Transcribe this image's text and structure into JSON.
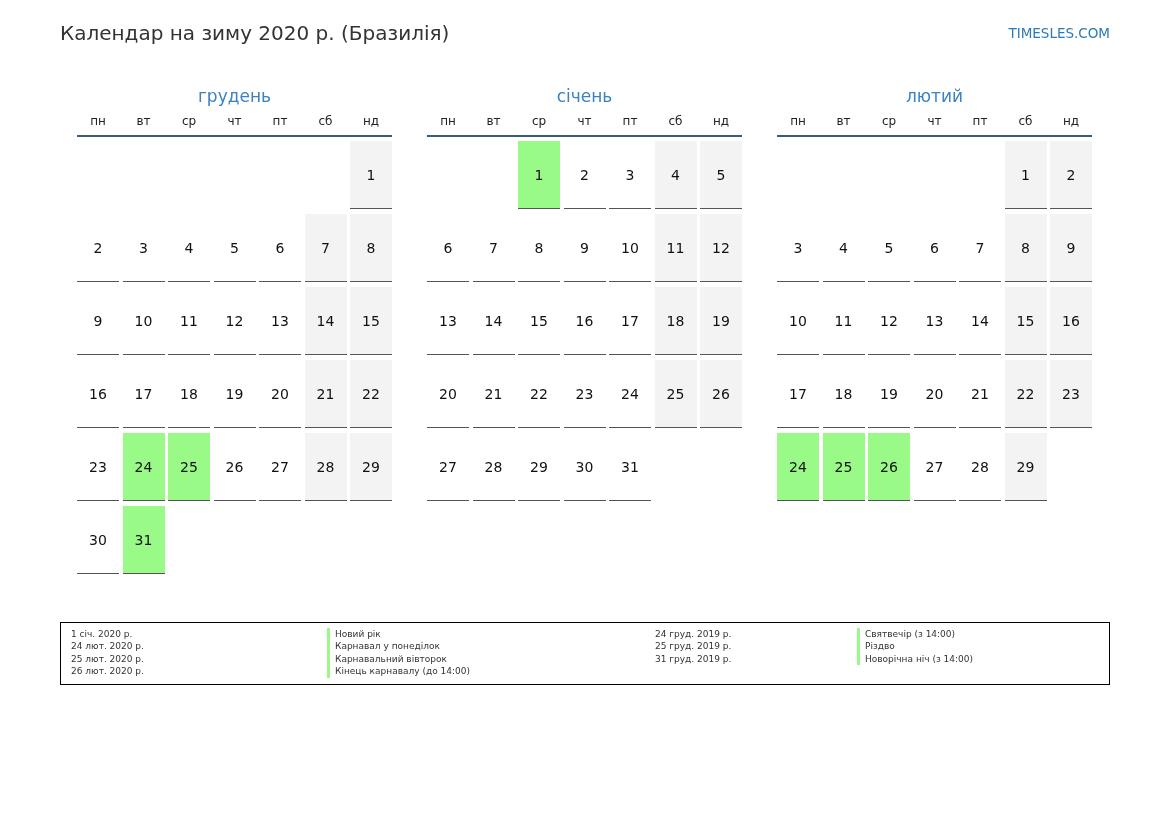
{
  "title": "Календар на зиму 2020 р. (Бразилія)",
  "site_link": "TIMESLES.COM",
  "months": [
    {
      "name": "грудень",
      "weekdays": [
        "пн",
        "вт",
        "ср",
        "чт",
        "пт",
        "сб",
        "нд"
      ],
      "weeks": [
        [
          {
            "day": "1",
            "kind": "weekend"
          }
        ],
        [
          {
            "day": "2",
            "kind": "workday"
          },
          {
            "day": "3",
            "kind": "workday"
          },
          {
            "day": "4",
            "kind": "workday"
          },
          {
            "day": "5",
            "kind": "workday"
          },
          {
            "day": "6",
            "kind": "workday"
          },
          {
            "day": "7",
            "kind": "weekend"
          },
          {
            "day": "8",
            "kind": "weekend"
          }
        ],
        [
          {
            "day": "9",
            "kind": "workday"
          },
          {
            "day": "10",
            "kind": "workday"
          },
          {
            "day": "11",
            "kind": "workday"
          },
          {
            "day": "12",
            "kind": "workday"
          },
          {
            "day": "13",
            "kind": "workday"
          },
          {
            "day": "14",
            "kind": "weekend"
          },
          {
            "day": "15",
            "kind": "weekend"
          }
        ],
        [
          {
            "day": "16",
            "kind": "workday"
          },
          {
            "day": "17",
            "kind": "workday"
          },
          {
            "day": "18",
            "kind": "workday"
          },
          {
            "day": "19",
            "kind": "workday"
          },
          {
            "day": "20",
            "kind": "workday"
          },
          {
            "day": "21",
            "kind": "weekend"
          },
          {
            "day": "22",
            "kind": "weekend"
          }
        ],
        [
          {
            "day": "23",
            "kind": "workday"
          },
          {
            "day": "24",
            "kind": "holiday"
          },
          {
            "day": "25",
            "kind": "holiday"
          },
          {
            "day": "26",
            "kind": "workday"
          },
          {
            "day": "27",
            "kind": "workday"
          },
          {
            "day": "28",
            "kind": "weekend"
          },
          {
            "day": "29",
            "kind": "weekend"
          }
        ],
        [
          {
            "day": "30",
            "kind": "workday"
          },
          {
            "day": "31",
            "kind": "holiday"
          }
        ]
      ]
    },
    {
      "name": "січень",
      "weekdays": [
        "пн",
        "вт",
        "ср",
        "чт",
        "пт",
        "сб",
        "нд"
      ],
      "weeks": [
        [
          {
            "day": "1",
            "kind": "holiday"
          },
          {
            "day": "2",
            "kind": "workday"
          },
          {
            "day": "3",
            "kind": "workday"
          },
          {
            "day": "4",
            "kind": "weekend"
          },
          {
            "day": "5",
            "kind": "weekend"
          }
        ],
        [
          {
            "day": "6",
            "kind": "workday"
          },
          {
            "day": "7",
            "kind": "workday"
          },
          {
            "day": "8",
            "kind": "workday"
          },
          {
            "day": "9",
            "kind": "workday"
          },
          {
            "day": "10",
            "kind": "workday"
          },
          {
            "day": "11",
            "kind": "weekend"
          },
          {
            "day": "12",
            "kind": "weekend"
          }
        ],
        [
          {
            "day": "13",
            "kind": "workday"
          },
          {
            "day": "14",
            "kind": "workday"
          },
          {
            "day": "15",
            "kind": "workday"
          },
          {
            "day": "16",
            "kind": "workday"
          },
          {
            "day": "17",
            "kind": "workday"
          },
          {
            "day": "18",
            "kind": "weekend"
          },
          {
            "day": "19",
            "kind": "weekend"
          }
        ],
        [
          {
            "day": "20",
            "kind": "workday"
          },
          {
            "day": "21",
            "kind": "workday"
          },
          {
            "day": "22",
            "kind": "workday"
          },
          {
            "day": "23",
            "kind": "workday"
          },
          {
            "day": "24",
            "kind": "workday"
          },
          {
            "day": "25",
            "kind": "weekend"
          },
          {
            "day": "26",
            "kind": "weekend"
          }
        ],
        [
          {
            "day": "27",
            "kind": "workday"
          },
          {
            "day": "28",
            "kind": "workday"
          },
          {
            "day": "29",
            "kind": "workday"
          },
          {
            "day": "30",
            "kind": "workday"
          },
          {
            "day": "31",
            "kind": "workday"
          }
        ]
      ]
    },
    {
      "name": "лютий",
      "weekdays": [
        "пн",
        "вт",
        "ср",
        "чт",
        "пт",
        "сб",
        "нд"
      ],
      "weeks": [
        [
          {
            "day": "1",
            "kind": "weekend"
          },
          {
            "day": "2",
            "kind": "weekend"
          }
        ],
        [
          {
            "day": "3",
            "kind": "workday"
          },
          {
            "day": "4",
            "kind": "workday"
          },
          {
            "day": "5",
            "kind": "workday"
          },
          {
            "day": "6",
            "kind": "workday"
          },
          {
            "day": "7",
            "kind": "workday"
          },
          {
            "day": "8",
            "kind": "weekend"
          },
          {
            "day": "9",
            "kind": "weekend"
          }
        ],
        [
          {
            "day": "10",
            "kind": "workday"
          },
          {
            "day": "11",
            "kind": "workday"
          },
          {
            "day": "12",
            "kind": "workday"
          },
          {
            "day": "13",
            "kind": "workday"
          },
          {
            "day": "14",
            "kind": "workday"
          },
          {
            "day": "15",
            "kind": "weekend"
          },
          {
            "day": "16",
            "kind": "weekend"
          }
        ],
        [
          {
            "day": "17",
            "kind": "workday"
          },
          {
            "day": "18",
            "kind": "workday"
          },
          {
            "day": "19",
            "kind": "workday"
          },
          {
            "day": "20",
            "kind": "workday"
          },
          {
            "day": "21",
            "kind": "workday"
          },
          {
            "day": "22",
            "kind": "weekend"
          },
          {
            "day": "23",
            "kind": "weekend"
          }
        ],
        [
          {
            "day": "24",
            "kind": "holiday"
          },
          {
            "day": "25",
            "kind": "holiday"
          },
          {
            "day": "26",
            "kind": "holiday"
          },
          {
            "day": "27",
            "kind": "workday"
          },
          {
            "day": "28",
            "kind": "workday"
          },
          {
            "day": "29",
            "kind": "weekend"
          }
        ]
      ]
    }
  ],
  "legend": [
    [
      {
        "date": "1 січ. 2020 р.",
        "name": "Новий рік"
      },
      {
        "date": "24 лют. 2020 р.",
        "name": "Карнавал у понеділок"
      },
      {
        "date": "25 лют. 2020 р.",
        "name": "Карнавальний вівторок"
      },
      {
        "date": "26 лют. 2020 р.",
        "name": "Кінець карнавалу (до 14:00)"
      }
    ],
    [
      {
        "date": "24 груд. 2019 р.",
        "name": "Святвечір (з 14:00)"
      },
      {
        "date": "25 груд. 2019 р.",
        "name": "Різдво"
      },
      {
        "date": "31 груд. 2019 р.",
        "name": "Новорічна ніч (з 14:00)"
      }
    ]
  ]
}
